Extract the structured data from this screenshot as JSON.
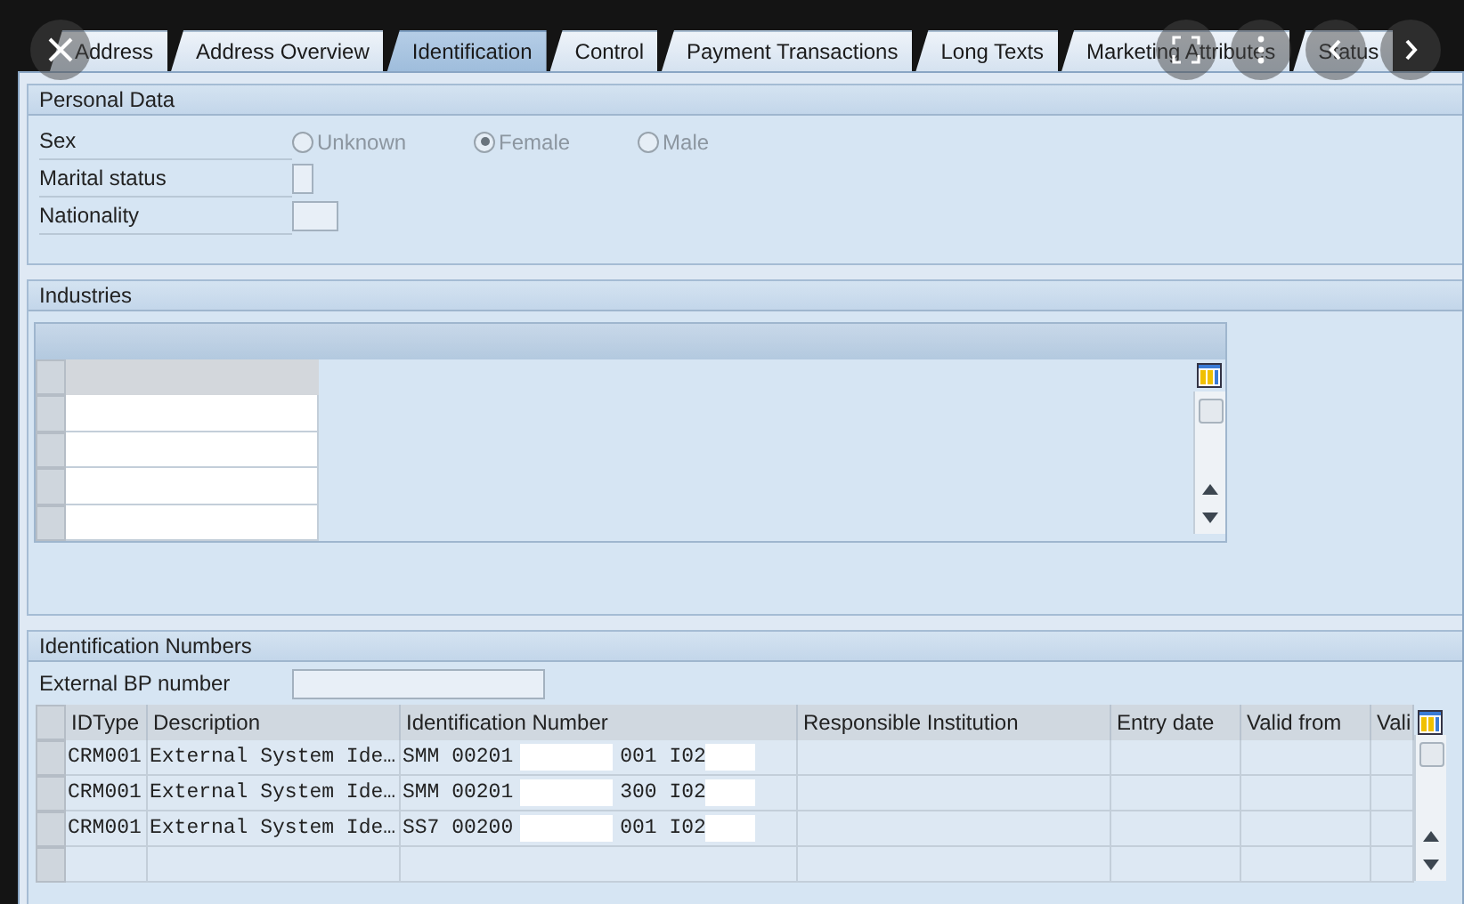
{
  "tabs": [
    {
      "label": "Address",
      "selected": false
    },
    {
      "label": "Address Overview",
      "selected": false
    },
    {
      "label": "Identification",
      "selected": true
    },
    {
      "label": "Control",
      "selected": false
    },
    {
      "label": "Payment Transactions",
      "selected": false
    },
    {
      "label": "Long Texts",
      "selected": false
    },
    {
      "label": "Marketing Attributes",
      "selected": false
    },
    {
      "label": "Status",
      "selected": false
    }
  ],
  "personal_data": {
    "title": "Personal Data",
    "sex": {
      "label": "Sex",
      "options": [
        {
          "label": "Unknown",
          "selected": false,
          "disabled": true
        },
        {
          "label": "Female",
          "selected": true,
          "disabled": true
        },
        {
          "label": "Male",
          "selected": false,
          "disabled": true
        }
      ]
    },
    "fields": [
      {
        "label": "Marital status",
        "kind": "narrow"
      },
      {
        "label": "Nationality",
        "kind": "wide"
      }
    ]
  },
  "industries": {
    "title": "Industries"
  },
  "identification_numbers": {
    "title": "Identification Numbers",
    "external_bp_number": {
      "label": "External BP number"
    },
    "columns": [
      "IDType",
      "Description",
      "Identification Number",
      "Responsible Institution",
      "Entry date",
      "Valid from",
      "Vali"
    ],
    "rows": [
      {
        "id_type": "CRM001",
        "description": "External System Ide…",
        "identification_number": [
          "SMM 00201",
          "001 I02"
        ]
      },
      {
        "id_type": "CRM001",
        "description": "External System Ide…",
        "identification_number": [
          "SMM 00201",
          "300 I02"
        ]
      },
      {
        "id_type": "CRM001",
        "description": "External System Ide…",
        "identification_number": [
          "SS7 00200",
          "001 I02"
        ]
      }
    ]
  }
}
